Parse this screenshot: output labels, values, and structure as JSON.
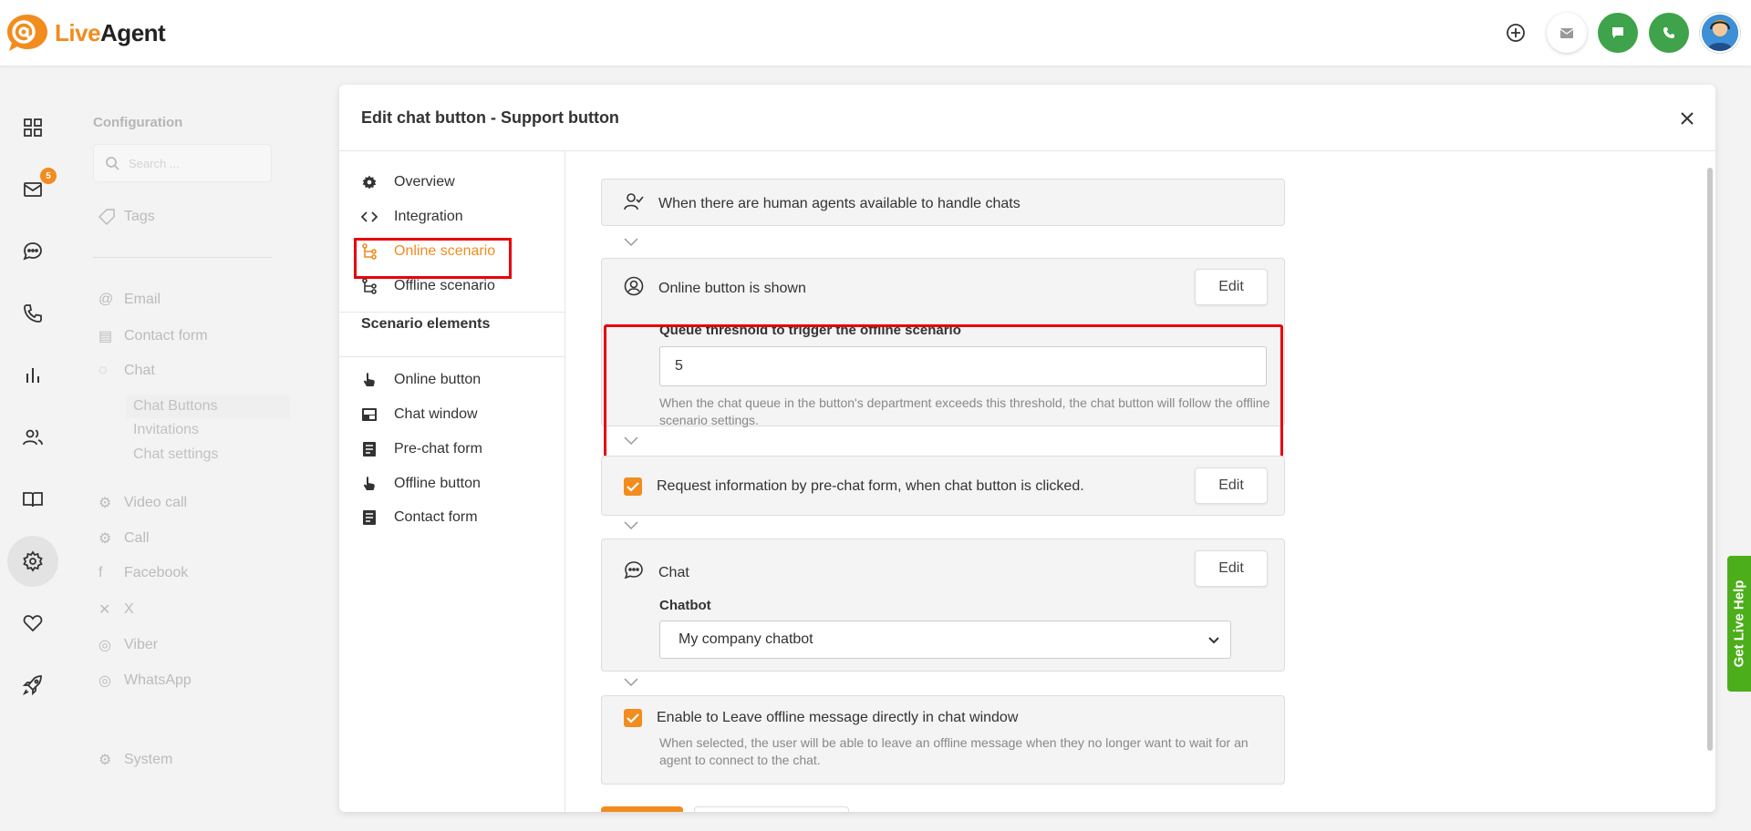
{
  "app": {
    "logo_live": "Live",
    "logo_agent": "Agent"
  },
  "leftnav": {
    "badge_count": "5"
  },
  "config": {
    "title": "Configuration",
    "search_placeholder": "Search ...",
    "items": [
      "Tags",
      "Email",
      "Contact form",
      "Chat",
      "Video call",
      "Call",
      "Facebook",
      "X",
      "Viber",
      "WhatsApp",
      "System"
    ],
    "chat_sub": [
      "Chat Buttons",
      "Invitations",
      "Chat settings"
    ]
  },
  "modal": {
    "title": "Edit chat button - Support button",
    "menu": [
      {
        "label": "Overview",
        "icon": "gear-icon"
      },
      {
        "label": "Integration",
        "icon": "code-icon"
      },
      {
        "label": "Online scenario",
        "icon": "flow-icon"
      },
      {
        "label": "Offline scenario",
        "icon": "flow-icon"
      }
    ],
    "elements_heading": "Scenario elements",
    "elements": [
      {
        "label": "Online button",
        "icon": "hand-pointer-icon"
      },
      {
        "label": "Chat window",
        "icon": "window-icon"
      },
      {
        "label": "Pre-chat form",
        "icon": "form-icon"
      },
      {
        "label": "Offline button",
        "icon": "hand-pointer-icon"
      },
      {
        "label": "Contact form",
        "icon": "form-icon"
      }
    ]
  },
  "scenario": {
    "agents_available": "When there are human agents available to handle chats",
    "online_shown": "Online button is shown",
    "edit_label": "Edit",
    "queue_label": "Queue threshold to trigger the offline scenario",
    "queue_value": "5",
    "queue_help": "When the chat queue in the button's department exceeds this threshold, the chat button will follow the offline scenario settings.",
    "prechat_label": "Request information by pre-chat form, when chat button is clicked.",
    "chat_title": "Chat",
    "chatbot_label": "Chatbot",
    "chatbot_value": "My company chatbot",
    "offline_msg_label": "Enable to Leave offline message directly in chat window",
    "offline_msg_help": "When selected, the user will be able to leave an offline message when they no longer want to wait for an agent to connect to the chat."
  },
  "live_help": "Get Live Help",
  "colors": {
    "brand_orange": "#f28c1e",
    "highlight_red": "#e8000a",
    "green": "#3ea34a"
  }
}
